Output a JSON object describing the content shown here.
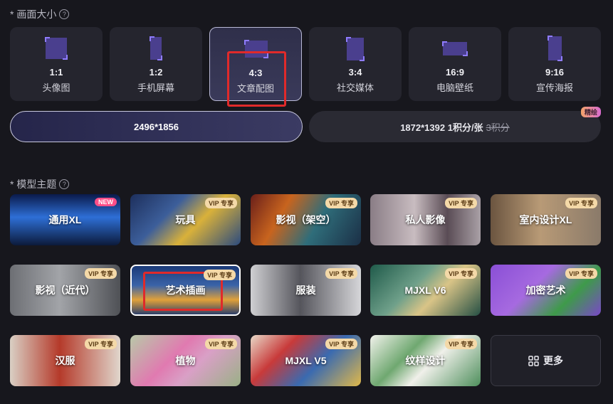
{
  "size_section": {
    "title": "* 画面大小",
    "help": "?"
  },
  "ratios": [
    {
      "ratio": "1:1",
      "label": "头像图"
    },
    {
      "ratio": "1:2",
      "label": "手机屏幕"
    },
    {
      "ratio": "4:3",
      "label": "文章配图"
    },
    {
      "ratio": "3:4",
      "label": "社交媒体"
    },
    {
      "ratio": "16:9",
      "label": "电脑壁纸"
    },
    {
      "ratio": "9:16",
      "label": "宣传海报"
    }
  ],
  "resolutions": {
    "left": "2496*1856",
    "right": {
      "main": "1872*1392 1积分/张",
      "strike": "3积分",
      "badge": "精绘"
    }
  },
  "model_section": {
    "title": "* 模型主题",
    "help": "?"
  },
  "models": [
    {
      "name": "通用XL",
      "badge": "NEW"
    },
    {
      "name": "玩具",
      "badge": "VIP 专享"
    },
    {
      "name": "影视（架空）",
      "badge": "VIP 专享"
    },
    {
      "name": "私人影像",
      "badge": "VIP 专享"
    },
    {
      "name": "室内设计XL",
      "badge": "VIP 专享"
    },
    {
      "name": "影视（近代）",
      "badge": "VIP 专享"
    },
    {
      "name": "艺术插画",
      "badge": "VIP 专享"
    },
    {
      "name": "服装",
      "badge": "VIP 专享"
    },
    {
      "name": "MJXL V6",
      "badge": "VIP 专享"
    },
    {
      "name": "加密艺术",
      "badge": "VIP 专享"
    },
    {
      "name": "汉服",
      "badge": "VIP 专享"
    },
    {
      "name": "植物",
      "badge": "VIP 专享"
    },
    {
      "name": "MJXL V5",
      "badge": "VIP 专享"
    },
    {
      "name": "纹样设计",
      "badge": "VIP 专享"
    }
  ],
  "more_label": "更多",
  "colors": {
    "background": "#17171d",
    "accent": "#8f7cff",
    "highlight_box": "#e02a2a",
    "vip_badge": "#f4d9a8",
    "new_badge": "#ff4f88"
  }
}
